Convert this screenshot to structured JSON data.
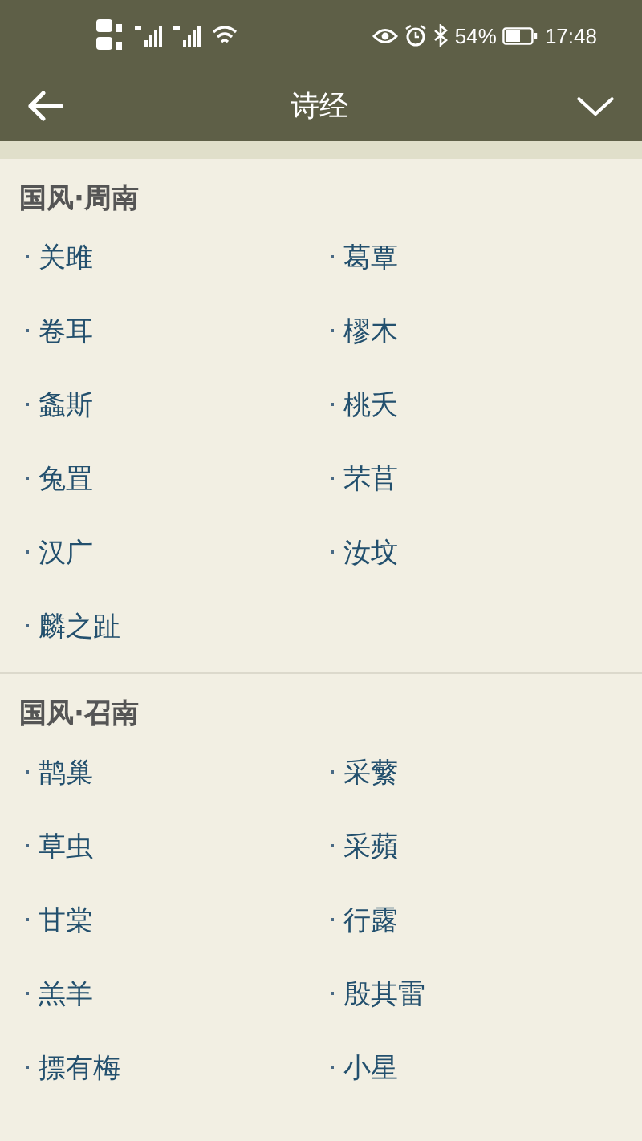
{
  "status_bar": {
    "time": "17:48",
    "battery": "54%"
  },
  "header": {
    "title": "诗经"
  },
  "sections": [
    {
      "title": "国风·周南",
      "items": [
        "关雎",
        "葛覃",
        "卷耳",
        "樛木",
        "螽斯",
        "桃夭",
        "兔罝",
        "芣苢",
        "汉广",
        "汝坟",
        "麟之趾"
      ]
    },
    {
      "title": "国风·召南",
      "items": [
        "鹊巢",
        "采蘩",
        "草虫",
        "采蘋",
        "甘棠",
        "行露",
        "羔羊",
        "殷其雷",
        "摽有梅",
        "小星"
      ]
    }
  ]
}
